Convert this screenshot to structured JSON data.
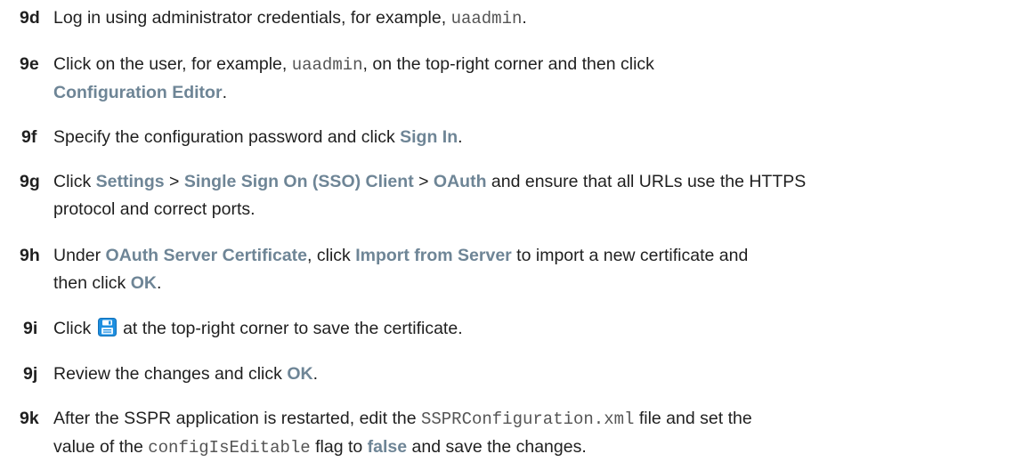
{
  "steps": [
    {
      "num": "9d",
      "segments": [
        {
          "t": "text",
          "v": "Log in using administrator credentials, for example, "
        },
        {
          "t": "code",
          "v": "uaadmin"
        },
        {
          "t": "text",
          "v": "."
        }
      ]
    },
    {
      "num": "9e",
      "segments": [
        {
          "t": "text",
          "v": "Click on the user, for example, "
        },
        {
          "t": "code",
          "v": "uaadmin"
        },
        {
          "t": "text",
          "v": ", on the top-right corner and then click"
        },
        {
          "t": "br"
        },
        {
          "t": "ui",
          "v": "Configuration Editor"
        },
        {
          "t": "text",
          "v": "."
        }
      ]
    },
    {
      "num": "9f",
      "segments": [
        {
          "t": "text",
          "v": "Specify the configuration password and click "
        },
        {
          "t": "ui",
          "v": "Sign In"
        },
        {
          "t": "text",
          "v": "."
        }
      ]
    },
    {
      "num": "9g",
      "segments": [
        {
          "t": "text",
          "v": "Click "
        },
        {
          "t": "ui",
          "v": "Settings"
        },
        {
          "t": "text",
          "v": " > "
        },
        {
          "t": "ui",
          "v": "Single Sign On (SSO) Client"
        },
        {
          "t": "text",
          "v": " > "
        },
        {
          "t": "ui",
          "v": "OAuth"
        },
        {
          "t": "text",
          "v": " and ensure that all URLs use the HTTPS"
        },
        {
          "t": "br"
        },
        {
          "t": "text",
          "v": "protocol and correct ports."
        }
      ]
    },
    {
      "num": "9h",
      "segments": [
        {
          "t": "text",
          "v": "Under "
        },
        {
          "t": "ui",
          "v": "OAuth Server Certificate"
        },
        {
          "t": "text",
          "v": ", click "
        },
        {
          "t": "ui",
          "v": "Import from Server"
        },
        {
          "t": "text",
          "v": " to import a new certificate and"
        },
        {
          "t": "br"
        },
        {
          "t": "text",
          "v": "then click "
        },
        {
          "t": "ui",
          "v": "OK"
        },
        {
          "t": "text",
          "v": "."
        }
      ]
    },
    {
      "num": "9i",
      "segments": [
        {
          "t": "text",
          "v": "Click "
        },
        {
          "t": "icon",
          "v": "save-icon"
        },
        {
          "t": "text",
          "v": " at the top-right corner to save the certificate."
        }
      ]
    },
    {
      "num": "9j",
      "segments": [
        {
          "t": "text",
          "v": "Review the changes and click "
        },
        {
          "t": "ui",
          "v": "OK"
        },
        {
          "t": "text",
          "v": "."
        }
      ]
    },
    {
      "num": "9k",
      "segments": [
        {
          "t": "text",
          "v": "After the SSPR application is restarted, edit the "
        },
        {
          "t": "code",
          "v": "SSPRConfiguration.xml"
        },
        {
          "t": "text",
          "v": " file and set the"
        },
        {
          "t": "br"
        },
        {
          "t": "text",
          "v": "value of the "
        },
        {
          "t": "code",
          "v": "configIsEditable"
        },
        {
          "t": "text",
          "v": " flag to "
        },
        {
          "t": "ui",
          "v": "false"
        },
        {
          "t": "text",
          "v": " and save the changes."
        }
      ]
    }
  ],
  "colors": {
    "ui_reference": "#6e8596",
    "body_text": "#1f1f1f",
    "code_text": "#555555",
    "save_icon_blue": "#1d8fe0"
  }
}
